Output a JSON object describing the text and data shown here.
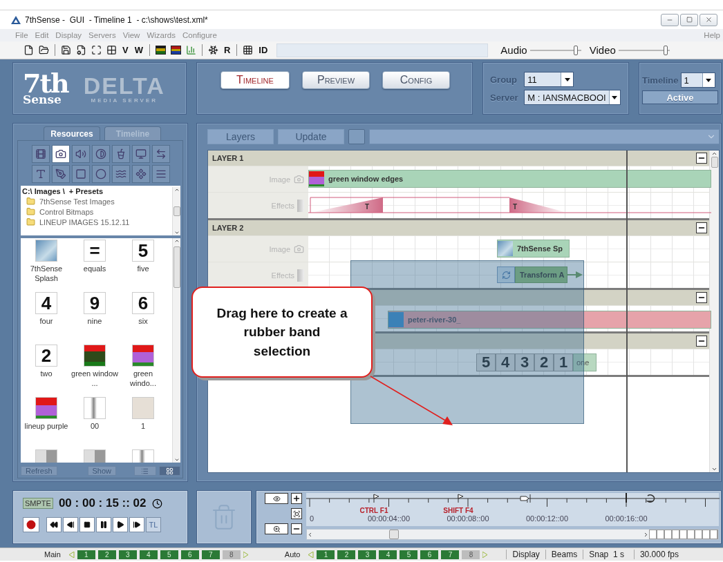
{
  "window": {
    "title": "7thSense -  GUI  - Timeline 1  - c:\\shows\\test.xml*"
  },
  "menu": {
    "items": [
      "File",
      "Edit",
      "Display",
      "Servers",
      "View",
      "Wizards",
      "Configure"
    ],
    "help": "Help"
  },
  "toolbar": {
    "groups": [
      [
        {
          "kind": "icon"
        },
        {
          "kind": "icon"
        }
      ],
      [
        {
          "kind": "icon"
        },
        {
          "kind": "icon"
        },
        {
          "kind": "icon"
        },
        {
          "kind": "icon"
        },
        {
          "kind": "text",
          "label": "V"
        },
        {
          "kind": "text",
          "label": "W"
        }
      ],
      [
        {
          "kind": "icon"
        },
        {
          "kind": "icon"
        },
        {
          "kind": "icon"
        }
      ],
      [
        {
          "kind": "icon"
        },
        {
          "kind": "text",
          "label": "R"
        }
      ],
      [
        {
          "kind": "icon"
        },
        {
          "kind": "text",
          "label": "ID"
        }
      ]
    ],
    "sliders": [
      {
        "label": "Audio",
        "level": 0.95
      },
      {
        "label": "Video",
        "level": 0.97
      }
    ]
  },
  "header": {
    "logo": {
      "mark": "7th",
      "mark_sub": "Sense",
      "product": "DELTA",
      "product_sub": "MEDIA SERVER"
    },
    "nav": [
      {
        "label": "Timeline",
        "selected": true
      },
      {
        "label": "Preview",
        "selected": false
      },
      {
        "label": "Config",
        "selected": false
      }
    ],
    "selectors": [
      {
        "label": "Group",
        "value": "11"
      },
      {
        "label": "Server",
        "value": "M : IANSMACBOOI"
      }
    ],
    "timeline": {
      "label": "Timeline",
      "value": "1",
      "status": "Active"
    }
  },
  "resources": {
    "tabs": [
      {
        "label": "Resources",
        "selected": true
      },
      {
        "label": "Timeline",
        "selected": false
      }
    ],
    "type_icons": [
      {
        "selected": false
      },
      {
        "selected": true
      },
      {
        "selected": false
      },
      {
        "selected": false
      },
      {
        "selected": false
      },
      {
        "selected": false
      },
      {
        "selected": false
      },
      {
        "selected": false
      },
      {
        "selected": false
      },
      {
        "selected": false
      },
      {
        "selected": false
      },
      {
        "selected": false
      },
      {
        "selected": false
      },
      {
        "selected": false
      }
    ],
    "path": "C:\\ Images \\  + Presets",
    "folders": [
      "7thSense Test Images",
      "Control Bitmaps",
      "LINEUP IMAGES 15.12.11"
    ],
    "thumbnails": [
      {
        "kind": "photo",
        "name": "7thSense Splash"
      },
      {
        "kind": "glyph",
        "glyph": "=",
        "name": "equals"
      },
      {
        "kind": "glyph",
        "glyph": "5",
        "name": "five"
      },
      {
        "kind": "glyph",
        "glyph": "4",
        "name": "four"
      },
      {
        "kind": "glyph",
        "glyph": "9",
        "name": "nine"
      },
      {
        "kind": "glyph",
        "glyph": "6",
        "name": "six"
      },
      {
        "kind": "glyph",
        "glyph": "2",
        "name": "two"
      },
      {
        "kind": "red_dark",
        "name": "green window ..."
      },
      {
        "kind": "red_purple",
        "name": "green windo..."
      },
      {
        "kind": "red_purple",
        "name": "lineup purple"
      },
      {
        "kind": "sketch",
        "name": "00"
      },
      {
        "kind": "plain",
        "name": "1"
      },
      {
        "kind": "grey"
      },
      {
        "kind": "grey"
      },
      {
        "kind": "sketch"
      }
    ],
    "buttons": [
      "Refresh",
      "Show"
    ],
    "view_modes": [
      {
        "selected": false
      },
      {
        "selected": true
      }
    ]
  },
  "timeline_panel": {
    "buttons": [
      "Layers",
      "Update"
    ],
    "layers": [
      {
        "title": "LAYER 1",
        "expanded": true,
        "tracks": [
          {
            "kind": "image",
            "label": "Image",
            "clips": [
              {
                "kind": "media",
                "thumbnail": {
                  "kind": "red_purple"
                },
                "color": "#a9d4b8",
                "label": "green window edges"
              }
            ]
          },
          {
            "kind": "effects",
            "label": "Effects",
            "clips": [
              {
                "kind": "fade_in",
                "label": "T"
              },
              {
                "kind": "fade_out",
                "label": "T"
              }
            ]
          }
        ]
      },
      {
        "title": "LAYER 2",
        "expanded": true,
        "tracks": [
          {
            "kind": "image",
            "label": "Image",
            "clips": [
              {
                "kind": "media",
                "thumbnail": {
                  "kind": "photo"
                },
                "color": "#a9d4b8",
                "label": "7thSense Sp"
              }
            ]
          },
          {
            "kind": "effects",
            "label": "Effects",
            "clips": [
              {
                "kind": "transform",
                "label": "Transform A"
              }
            ]
          }
        ]
      },
      {
        "expanded": true,
        "tracks": [
          {
            "kind": "image",
            "clips": [
              {
                "kind": "media",
                "thumbnail": {
                  "kind": "blue"
                },
                "color": "#e6a3aa",
                "label": "peter-river-30_"
              }
            ]
          }
        ]
      },
      {
        "expanded": true,
        "tracks": [
          {
            "kind": "image",
            "clips": [
              {
                "kind": "countdown",
                "frames": [
                  "5",
                  "4",
                  "3",
                  "2",
                  "1"
                ],
                "label": "one"
              }
            ]
          }
        ]
      }
    ]
  },
  "callout": "Drag here to create a rubber band selection",
  "transport": {
    "smpte": "SMPTE",
    "timecode": "00 : 00 : 15 :: 02",
    "tl": "TL"
  },
  "ruler": {
    "markers": [
      {
        "kind": "cue",
        "label": "CTRL F1"
      },
      {
        "kind": "cue",
        "label": "SHIFT F4"
      },
      {
        "kind": "loop"
      },
      {
        "kind": "return"
      }
    ],
    "times": [
      "0",
      "00:00:04::00",
      "00:00:08::00",
      "00:00:12::00",
      "00:00:16::00"
    ]
  },
  "status_bar": {
    "groups": [
      {
        "label": "Main",
        "buttons": [
          {
            "label": "1",
            "enabled": true
          },
          {
            "label": "2",
            "enabled": true
          },
          {
            "label": "3",
            "enabled": true
          },
          {
            "label": "4",
            "enabled": true
          },
          {
            "label": "5",
            "enabled": true
          },
          {
            "label": "6",
            "enabled": true
          },
          {
            "label": "7",
            "enabled": true
          },
          {
            "label": "8",
            "enabled": false
          }
        ]
      },
      {
        "label": "Auto",
        "buttons": [
          {
            "label": "1",
            "enabled": true
          },
          {
            "label": "2",
            "enabled": true
          },
          {
            "label": "3",
            "enabled": true
          },
          {
            "label": "4",
            "enabled": true
          },
          {
            "label": "5",
            "enabled": true
          },
          {
            "label": "6",
            "enabled": true
          },
          {
            "label": "7",
            "enabled": true
          },
          {
            "label": "8",
            "enabled": false
          }
        ]
      }
    ],
    "fields": [
      "Display",
      "Beams",
      "Snap  1 s",
      "30.000 fps"
    ]
  }
}
